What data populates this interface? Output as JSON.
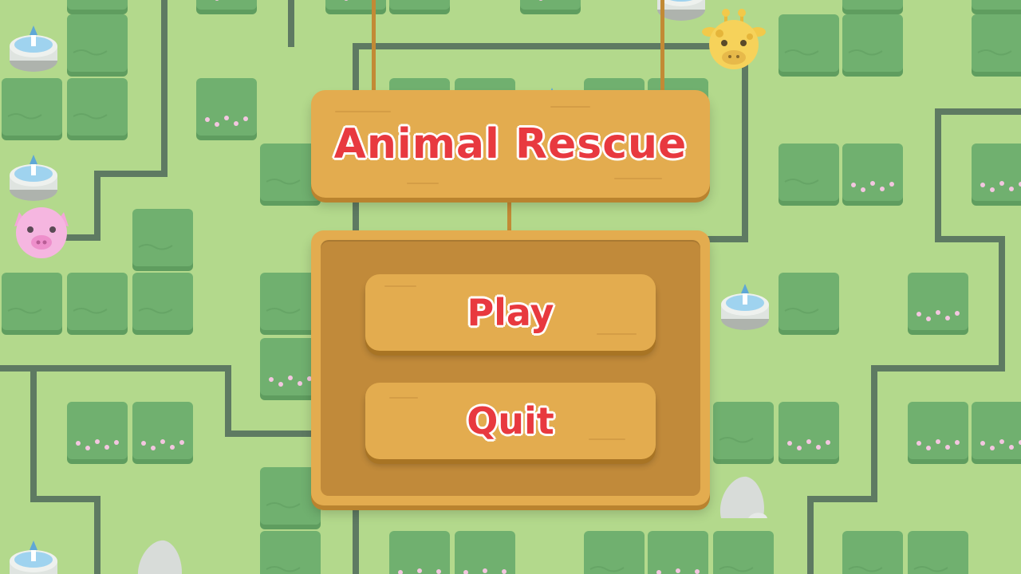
{
  "game": {
    "title": "Animal Rescue"
  },
  "menu": {
    "play_label": "Play",
    "quit_label": "Quit"
  },
  "colors": {
    "grass": "#b3d98c",
    "hedge": "#6fb26e",
    "wall": "#5e7a62",
    "wood": "#e3ac4f",
    "wood_dark": "#c18a3a",
    "label_red": "#e8393f"
  },
  "map_objects": {
    "animals": [
      "pig-icon",
      "giraffe-icon"
    ],
    "decorations": [
      "fountain-icon",
      "rock-icon",
      "flower-bush-icon"
    ]
  }
}
